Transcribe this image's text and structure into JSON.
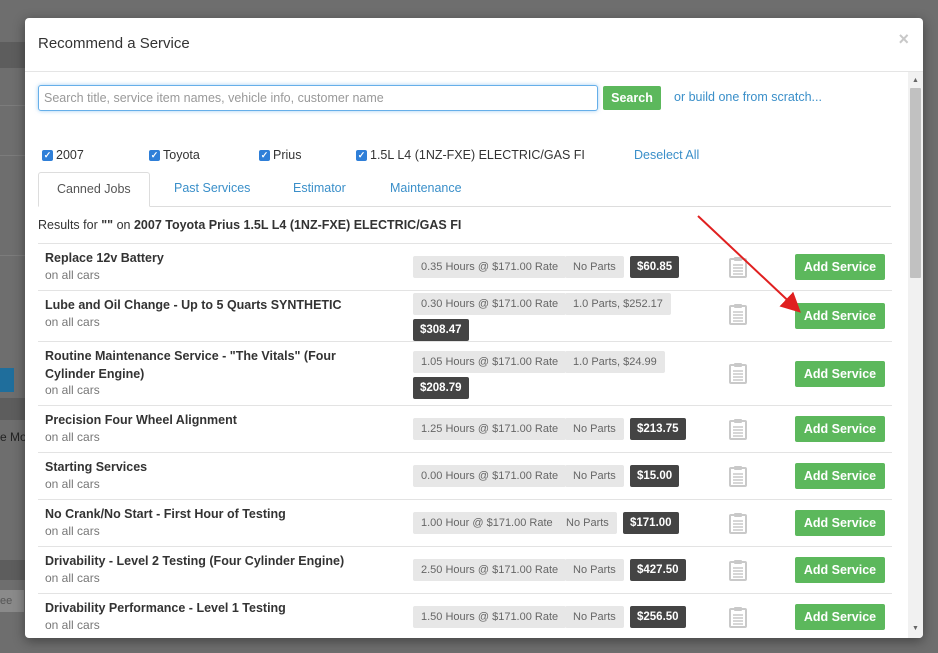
{
  "modal": {
    "title": "Recommend a Service",
    "close_glyph": "×"
  },
  "search": {
    "placeholder": "Search title, service item names, vehicle info, customer name",
    "value": "",
    "button_label": "Search",
    "scratch_link": "or build one from scratch..."
  },
  "filters": {
    "items": [
      {
        "label": "2007",
        "checked": true
      },
      {
        "label": "Toyota",
        "checked": true
      },
      {
        "label": "Prius",
        "checked": true
      },
      {
        "label": "1.5L L4 (1NZ-FXE) ELECTRIC/GAS FI",
        "checked": true
      }
    ],
    "deselect_label": "Deselect All",
    "check_glyph": "✓"
  },
  "tabs": [
    {
      "label": "Canned Jobs",
      "active": true
    },
    {
      "label": "Past Services",
      "active": false
    },
    {
      "label": "Estimator",
      "active": false
    },
    {
      "label": "Maintenance",
      "active": false
    }
  ],
  "results": {
    "prefix": "Results for",
    "query": "\"\"",
    "on": "on",
    "vehicle": "2007 Toyota Prius 1.5L L4 (1NZ-FXE) ELECTRIC/GAS FI"
  },
  "jobs": [
    {
      "name": "Replace 12v Battery",
      "sub": "on all cars",
      "hours": "0.35 Hours @ $171.00 Rate",
      "parts": "No Parts",
      "total": "$60.85",
      "button": "Add Service"
    },
    {
      "name": "Lube and Oil Change - Up to 5 Quarts SYNTHETIC",
      "sub": "on all cars",
      "hours": "0.30 Hours @ $171.00 Rate",
      "parts": "1.0 Parts, $252.17",
      "total": "$308.47",
      "button": "Add Service"
    },
    {
      "name": "Routine Maintenance Service - \"The Vitals\" (Four Cylinder Engine)",
      "sub": "on all cars",
      "hours": "1.05 Hours @ $171.00 Rate",
      "parts": "1.0 Parts, $24.99",
      "total": "$208.79",
      "button": "Add Service"
    },
    {
      "name": "Precision Four Wheel Alignment",
      "sub": "on all cars",
      "hours": "1.25 Hours @ $171.00 Rate",
      "parts": "No Parts",
      "total": "$213.75",
      "button": "Add Service"
    },
    {
      "name": "Starting Services",
      "sub": "on all cars",
      "hours": "0.00 Hours @ $171.00 Rate",
      "parts": "No Parts",
      "total": "$15.00",
      "button": "Add Service"
    },
    {
      "name": "No Crank/No Start - First Hour of Testing",
      "sub": "on all cars",
      "hours": "1.00 Hour @ $171.00 Rate",
      "parts": "No Parts",
      "total": "$171.00",
      "button": "Add Service"
    },
    {
      "name": "Drivability - Level 2 Testing (Four Cylinder Engine)",
      "sub": "on all cars",
      "hours": "2.50 Hours @ $171.00 Rate",
      "parts": "No Parts",
      "total": "$427.50",
      "button": "Add Service"
    },
    {
      "name": "Drivability Performance - Level 1 Testing",
      "sub": "on all cars",
      "hours": "1.50 Hours @ $171.00 Rate",
      "parts": "No Parts",
      "total": "$256.50",
      "button": "Add Service"
    }
  ],
  "background": {
    "partial_text": "e Mo",
    "partial_input": "ee"
  },
  "colors": {
    "accent_green": "#5cb85c",
    "link_blue": "#3a8fc9",
    "total_badge": "#444444",
    "annotation_arrow": "#e02020"
  },
  "icons": {
    "job_icon": "clipboard-icon",
    "scroll_up": "scroll-up-arrow-icon",
    "scroll_down": "scroll-down-arrow-icon"
  }
}
